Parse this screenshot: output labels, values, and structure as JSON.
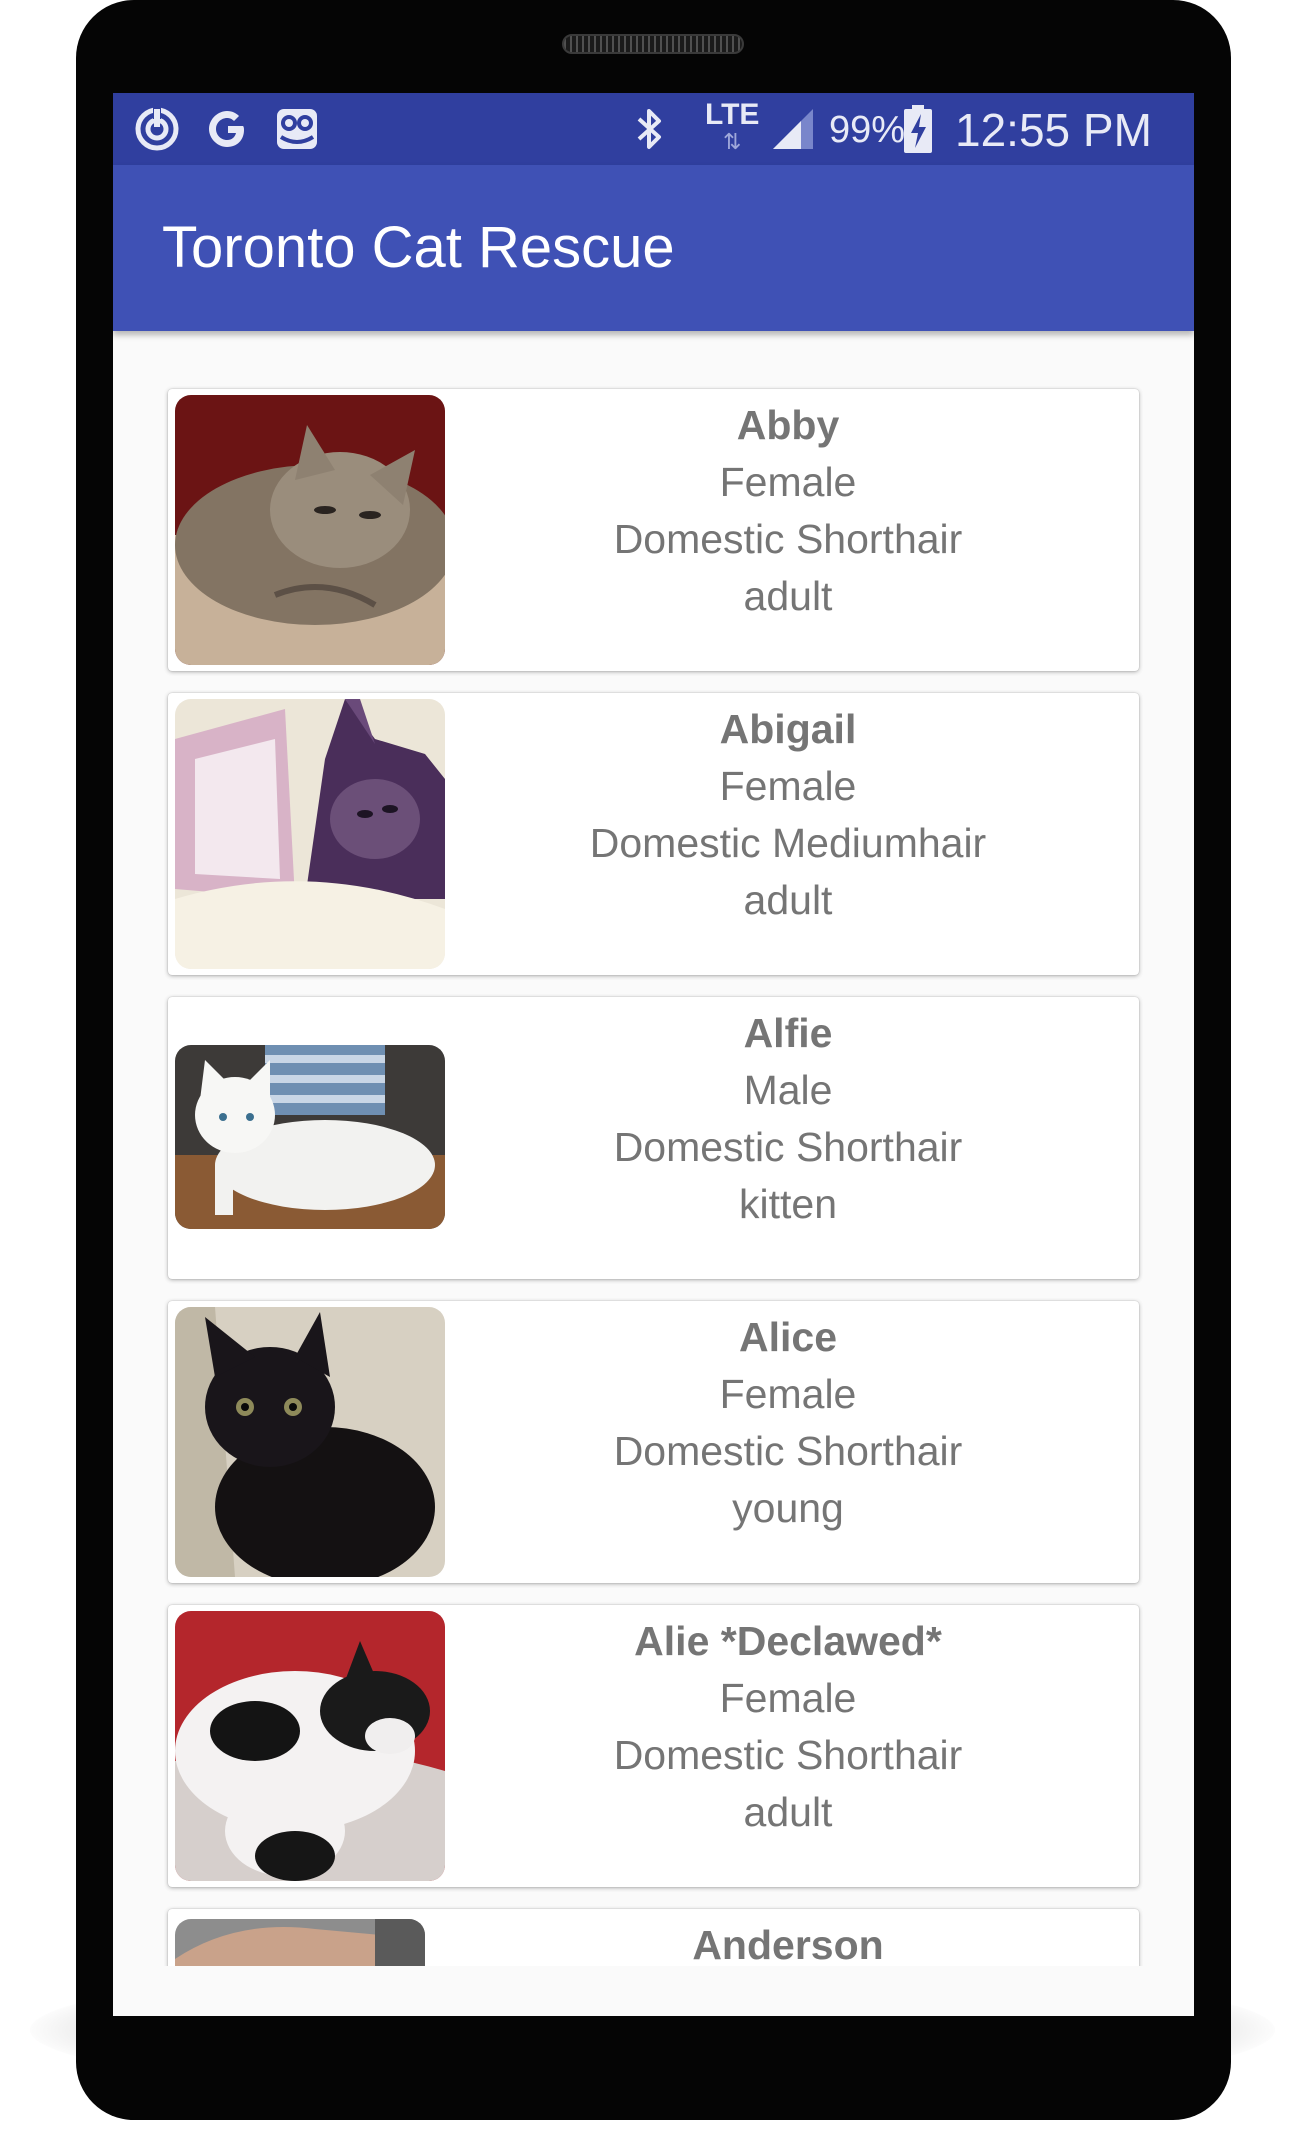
{
  "status_bar": {
    "network": "LTE",
    "battery": "99%",
    "time": "12:55 PM",
    "icons": [
      "sync-icon",
      "google-icon",
      "owl-icon",
      "bluetooth-icon",
      "lte-icon",
      "signal-icon",
      "battery-charging-icon"
    ]
  },
  "app_bar": {
    "title": "Toronto Cat Rescue"
  },
  "cats": [
    {
      "name": "Abby",
      "sex": "Female",
      "breed": "Domestic Shorthair",
      "age": "adult"
    },
    {
      "name": "Abigail",
      "sex": "Female",
      "breed": "Domestic Mediumhair",
      "age": "adult"
    },
    {
      "name": "Alfie",
      "sex": "Male",
      "breed": "Domestic Shorthair",
      "age": "kitten"
    },
    {
      "name": "Alice",
      "sex": "Female",
      "breed": "Domestic Shorthair",
      "age": "young"
    },
    {
      "name": "Alie *Declawed*",
      "sex": "Female",
      "breed": "Domestic Shorthair",
      "age": "adult"
    },
    {
      "name": "Anderson"
    }
  ],
  "colors": {
    "status_bar": "#303f9f",
    "app_bar": "#3f51b5",
    "card_text": "#757575",
    "background": "#fafafa"
  }
}
